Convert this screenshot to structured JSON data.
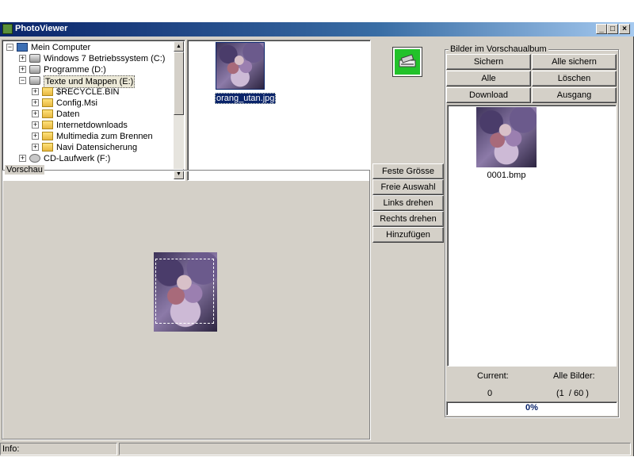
{
  "window": {
    "title": "PhotoViewer",
    "controls": {
      "minimize": "_",
      "maximize": "□",
      "close": "×"
    }
  },
  "tree": {
    "items": [
      {
        "label": "Mein Computer",
        "icon": "computer-icon",
        "expander": "−",
        "level": 0
      },
      {
        "label": "Windows 7 Betriebssystem (C:)",
        "icon": "drive-icon",
        "expander": "+",
        "level": 1
      },
      {
        "label": "Programme (D:)",
        "icon": "drive-icon",
        "expander": "+",
        "level": 1
      },
      {
        "label": "Texte und Mappen (E:)",
        "icon": "drive-icon",
        "expander": "−",
        "level": 1,
        "selected": true
      },
      {
        "label": "$RECYCLE.BIN",
        "icon": "folder-icon",
        "expander": "+",
        "level": 2
      },
      {
        "label": "Config.Msi",
        "icon": "folder-icon",
        "expander": "+",
        "level": 2
      },
      {
        "label": "Daten",
        "icon": "folder-icon",
        "expander": "+",
        "level": 2
      },
      {
        "label": "Internetdownloads",
        "icon": "folder-icon",
        "expander": "+",
        "level": 2
      },
      {
        "label": "Multimedia zum Brennen",
        "icon": "folder-icon",
        "expander": "+",
        "level": 2
      },
      {
        "label": "Navi Datensicherung",
        "icon": "folder-icon",
        "expander": "+",
        "level": 2
      },
      {
        "label": "CD-Laufwerk (F:)",
        "icon": "cd-icon",
        "expander": "+",
        "level": 1
      }
    ]
  },
  "file_list": {
    "items": [
      {
        "name": "orang_utan.jpg",
        "selected": true
      }
    ]
  },
  "scanner_button": {
    "icon": "scanner-icon"
  },
  "preview": {
    "title": "Vorschau"
  },
  "tools": {
    "fixed_size": "Feste Grösse",
    "free_select": "Freie Auswahl",
    "rotate_left": "Links drehen",
    "rotate_right": "Rechts drehen",
    "add": "Hinzufügen"
  },
  "album": {
    "title": "Bilder im Vorschaualbum",
    "buttons": {
      "save": "Sichern",
      "save_all": "Alle sichern",
      "all": "Alle",
      "delete": "Löschen",
      "download": "Download",
      "exit": "Ausgang"
    },
    "items": [
      {
        "name": "0001.bmp"
      }
    ],
    "current_label": "Current:",
    "all_label": "Alle Bilder:",
    "current_value": "0",
    "all_value": "(1  / 60 )",
    "progress_text": "0%",
    "progress_fraction": 0
  },
  "status": {
    "info_label": "Info:"
  },
  "colors": {
    "face": "#d4d0c8",
    "selection": "#0a246a",
    "scanner_green": "#22c22a"
  }
}
